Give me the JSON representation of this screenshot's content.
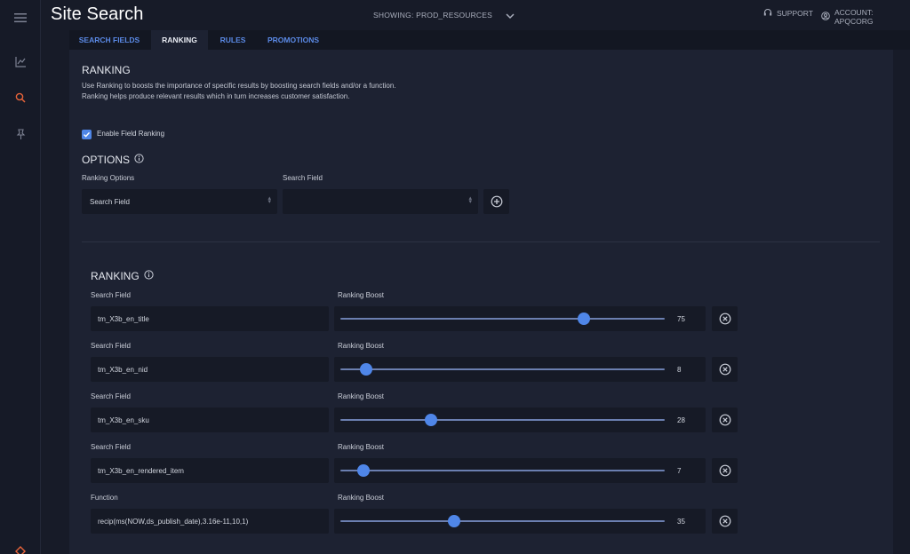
{
  "header": {
    "title": "Site Search",
    "showing": "SHOWING: PROD_RESOURCES",
    "support": "SUPPORT",
    "account": "ACCOUNT: APQCORG"
  },
  "tabs": [
    {
      "label": "SEARCH FIELDS",
      "active": false
    },
    {
      "label": "RANKING",
      "active": true
    },
    {
      "label": "RULES",
      "active": false
    },
    {
      "label": "PROMOTIONS",
      "active": false
    }
  ],
  "ranking": {
    "heading": "RANKING",
    "description": "Use Ranking to boosts the importance of specific results by boosting search fields and/or a function. Ranking helps produce relevant results which in turn increases customer satisfaction.",
    "enable_label": "Enable Field Ranking",
    "enabled": true
  },
  "options": {
    "heading": "OPTIONS",
    "ranking_options_label": "Ranking Options",
    "ranking_options_value": "Search Field",
    "search_field_label": "Search Field",
    "search_field_value": ""
  },
  "ranking_list": {
    "heading": "RANKING",
    "boost_label": "Ranking Boost",
    "max_boost": 100,
    "rows": [
      {
        "label": "Search Field",
        "value": "tm_X3b_en_title",
        "boost": 75
      },
      {
        "label": "Search Field",
        "value": "tm_X3b_en_nid",
        "boost": 8
      },
      {
        "label": "Search Field",
        "value": "tm_X3b_en_sku",
        "boost": 28
      },
      {
        "label": "Search Field",
        "value": "tm_X3b_en_rendered_item",
        "boost": 7
      },
      {
        "label": "Function",
        "value": "recip(ms(NOW,ds_publish_date),3.16e-11,10,1)",
        "boost": 35
      }
    ]
  },
  "colors": {
    "accent": "#4f86e8",
    "tab_link": "#5b8ae6",
    "background": "#171b28",
    "panel": "#1d2232",
    "nav_active_icon": "#e8643a"
  },
  "icons": {
    "menu": "menu-icon",
    "analytics": "chart-line-icon",
    "search": "search-icon",
    "pin": "pin-icon",
    "brand": "brand-logo-icon"
  }
}
